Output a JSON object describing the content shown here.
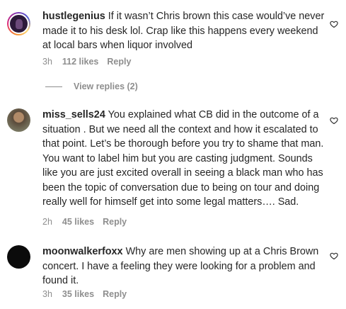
{
  "comments": [
    {
      "username": "hustlegenius",
      "text": "If it wasn’t Chris brown this case would’ve never made it to his desk lol. Crap like this happens every weekend at local bars when liquor involved",
      "time": "3h",
      "likes": "112 likes",
      "reply": "Reply"
    },
    {
      "username": "miss_sells24",
      "text": "You explained what CB did in the outcome of a situation . But we need all the context and how it escalated to that point. Let’s be thorough before you try to shame that man. You want to label him but you are casting judgment. Sounds like you are just excited overall in seeing a black man who has been the topic of conversation due to being on tour and doing really well for himself get into some legal matters…. Sad.",
      "time": "2h",
      "likes": "45 likes",
      "reply": "Reply"
    },
    {
      "username": "moonwalkerfoxx",
      "text": "Why are men showing up at a Chris Brown concert. I have a feeling they were looking for a problem and found it.",
      "time": "3h",
      "likes": "35 likes",
      "reply": "Reply"
    }
  ],
  "view_replies": "View replies (2)",
  "icons": {
    "heart": "heart-outline-icon"
  },
  "colors": {
    "text": "#262626",
    "secondary": "#8e8e8e",
    "background": "#ffffff"
  }
}
